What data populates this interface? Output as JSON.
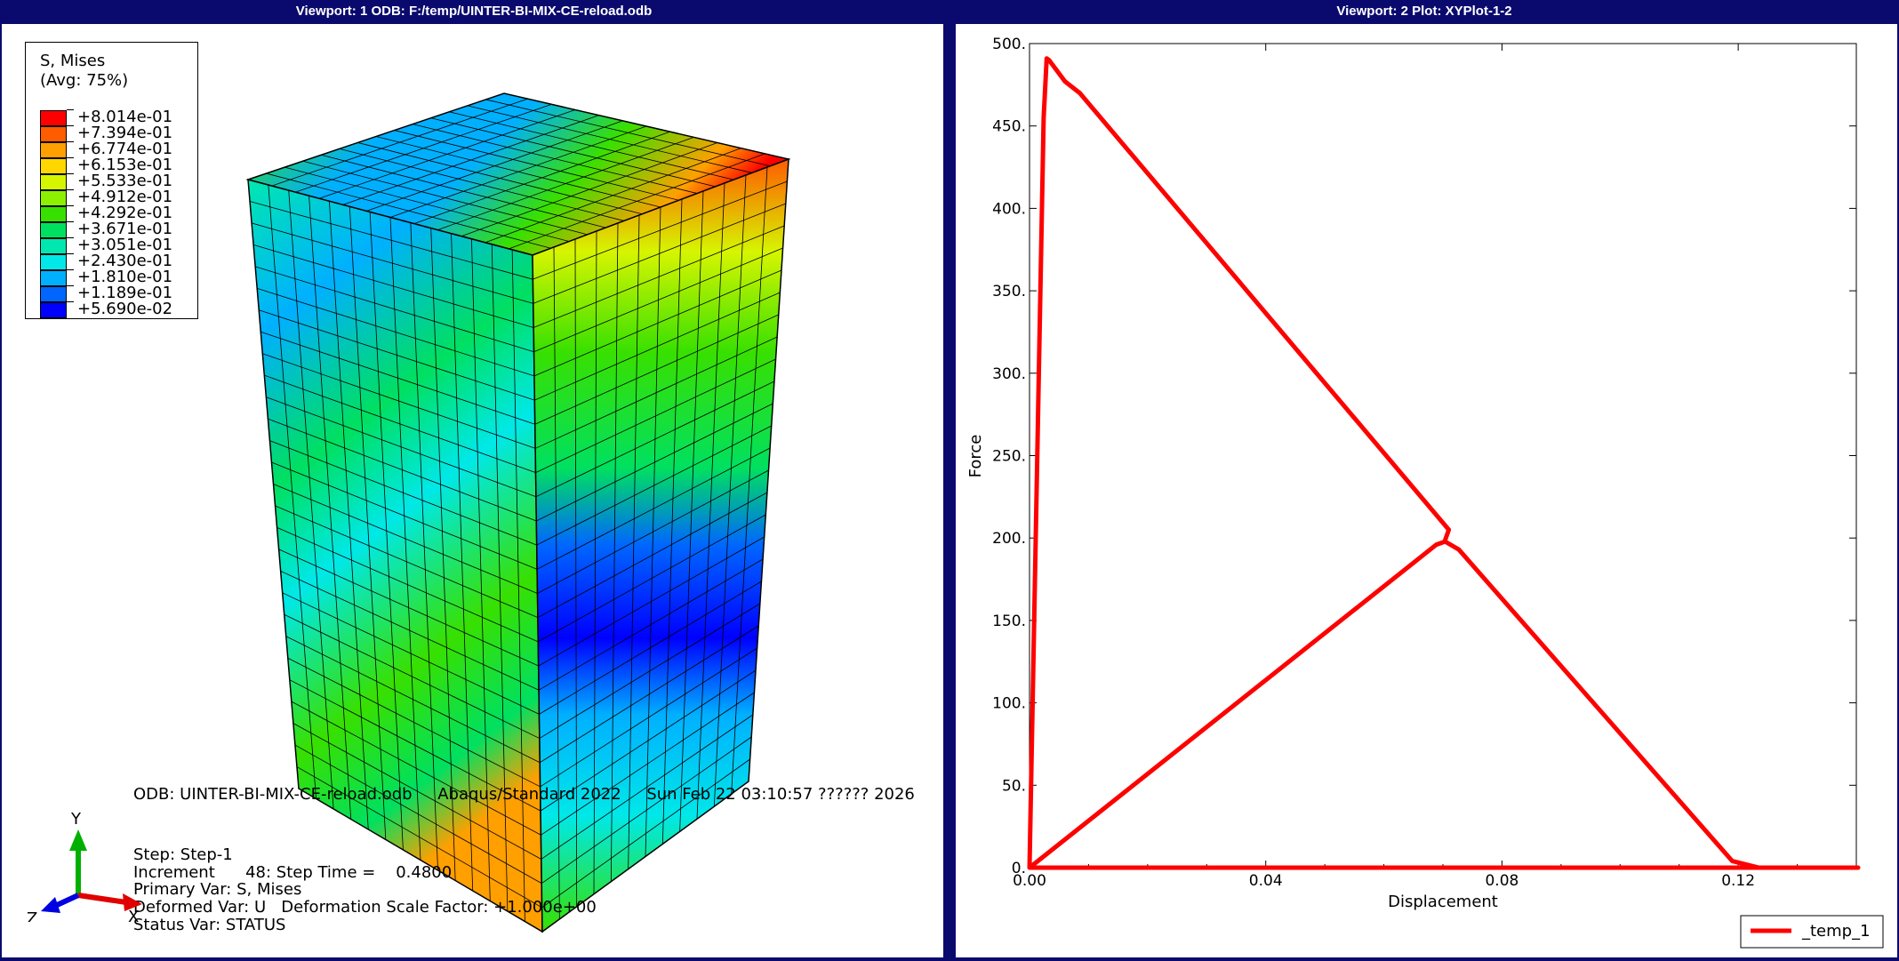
{
  "viewport1": {
    "title": "Viewport: 1     ODB: F:/temp/UINTER-BI-MIX-CE-reload.odb",
    "legend": {
      "title_line1": "S, Mises",
      "title_line2": "(Avg: 75%)",
      "entries": [
        {
          "label": "+8.014e-01",
          "color": "#ff0000"
        },
        {
          "label": "+7.394e-01",
          "color": "#ff5c00"
        },
        {
          "label": "+6.774e-01",
          "color": "#ff9f00"
        },
        {
          "label": "+6.153e-01",
          "color": "#ffd600"
        },
        {
          "label": "+5.533e-01",
          "color": "#d6f500"
        },
        {
          "label": "+4.912e-01",
          "color": "#8cf000"
        },
        {
          "label": "+4.292e-01",
          "color": "#38e000"
        },
        {
          "label": "+3.671e-01",
          "color": "#00e060"
        },
        {
          "label": "+3.051e-01",
          "color": "#00e8b0"
        },
        {
          "label": "+2.430e-01",
          "color": "#00e8e8"
        },
        {
          "label": "+1.810e-01",
          "color": "#00b0ff"
        },
        {
          "label": "+1.189e-01",
          "color": "#0066ff"
        },
        {
          "label": "+5.690e-02",
          "color": "#0000ff"
        }
      ]
    },
    "info": {
      "odb_line": "ODB: UINTER-BI-MIX-CE-reload.odb     Abaqus/Standard 2022     Sun Feb 22 03:10:57 ?????? 2026",
      "step": "Step: Step-1",
      "increment": "Increment      48: Step Time =    0.4800",
      "primary": "Primary Var: S, Mises",
      "deformed": "Deformed Var: U   Deformation Scale Factor: +1.000e+00",
      "status": "Status Var: STATUS"
    },
    "triad": {
      "y": "Y",
      "x": "X",
      "z": "Z",
      "y_color": "#00b000",
      "x_color": "#e00000",
      "z_color": "#0000e0"
    }
  },
  "viewport2": {
    "title": "Viewport: 2     Plot: XYPlot-1-2",
    "legend_label": "_temp_1",
    "line_color": "#ff0000"
  },
  "chart_data": {
    "type": "line",
    "xlabel": "Displacement",
    "ylabel": "Force",
    "xlim": [
      0,
      0.14
    ],
    "ylim": [
      0,
      500
    ],
    "xticks": [
      {
        "value": 0.0,
        "label": "0.00"
      },
      {
        "value": 0.04,
        "label": "0.04"
      },
      {
        "value": 0.08,
        "label": "0.08"
      },
      {
        "value": 0.12,
        "label": "0.12"
      }
    ],
    "yticks": [
      {
        "value": 0,
        "label": "0."
      },
      {
        "value": 50,
        "label": "50."
      },
      {
        "value": 100,
        "label": "100."
      },
      {
        "value": 150,
        "label": "150."
      },
      {
        "value": 200,
        "label": "200."
      },
      {
        "value": 250,
        "label": "250."
      },
      {
        "value": 300,
        "label": "300."
      },
      {
        "value": 350,
        "label": "350."
      },
      {
        "value": 400,
        "label": "400."
      },
      {
        "value": 450,
        "label": "450."
      },
      {
        "value": 500,
        "label": "500."
      }
    ],
    "series": [
      {
        "name": "_temp_1",
        "x": [
          0.0,
          0.0024,
          0.0029,
          0.0033,
          0.006,
          0.0085,
          0.071,
          0.0703,
          0.0727,
          0.119,
          0.1235,
          0.138,
          0.1403,
          0.136,
          0.12,
          0.07,
          0.0,
          0.0,
          0.0689,
          0.0705
        ],
        "y": [
          0,
          455,
          491,
          490,
          477,
          470,
          205,
          198,
          193,
          4,
          0,
          0,
          0,
          0,
          0,
          0,
          0,
          0,
          196,
          198
        ]
      }
    ]
  }
}
